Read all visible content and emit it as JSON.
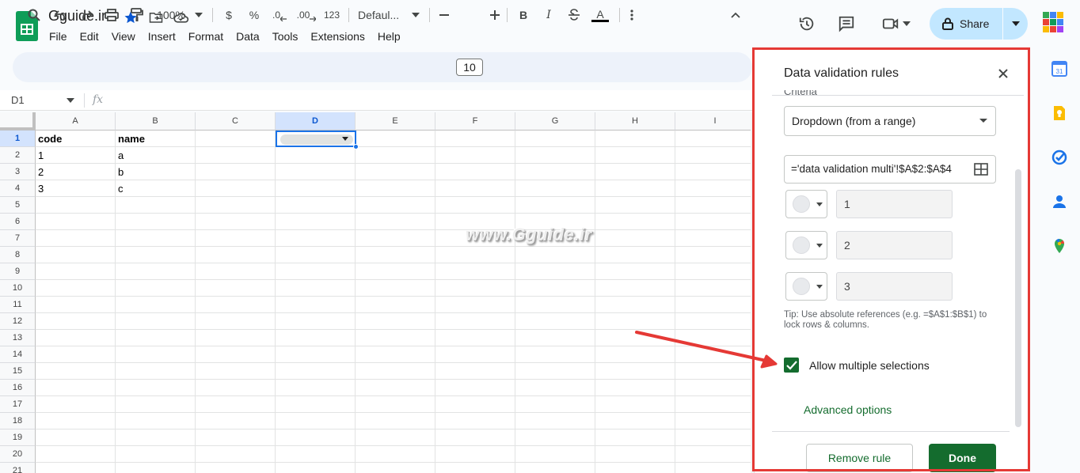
{
  "header": {
    "doc_title": "Gguide.ir",
    "menu": [
      "File",
      "Edit",
      "View",
      "Insert",
      "Format",
      "Data",
      "Tools",
      "Extensions",
      "Help"
    ],
    "share_label": "Share"
  },
  "toolbar": {
    "zoom": "100%",
    "currency": "$",
    "percent": "%",
    "dec_decrease": ".0",
    "dec_increase": ".00",
    "number_format": "123",
    "font_family": "Defaul...",
    "font_size": "10",
    "bold": "B",
    "italic": "I",
    "text_color": "A"
  },
  "formula_bar": {
    "name_box": "D1",
    "fx": "fx"
  },
  "grid": {
    "columns": [
      "A",
      "B",
      "C",
      "D",
      "E",
      "F",
      "G",
      "H",
      "I"
    ],
    "rows": [
      "1",
      "2",
      "3",
      "4",
      "5",
      "6",
      "7",
      "8",
      "9",
      "10",
      "11",
      "12",
      "13",
      "14",
      "15",
      "16",
      "17",
      "18",
      "19",
      "20",
      "21"
    ],
    "cells": {
      "A1": "code",
      "B1": "name",
      "A2": "1",
      "B2": "a",
      "A3": "2",
      "B3": "b",
      "A4": "3",
      "B4": "c"
    },
    "selected_cell": "D1"
  },
  "watermark": "www.Gguide.ir",
  "panel": {
    "title": "Data validation rules",
    "criteria_label": "Criteria",
    "criteria_value": "Dropdown (from a range)",
    "range_value": "='data validation multi'!$A$2:$A$4",
    "options": [
      "1",
      "2",
      "3"
    ],
    "tip": "Tip: Use absolute references (e.g. =$A$1:$B$1) to lock rows & columns.",
    "allow_multiple_label": "Allow multiple selections",
    "allow_multiple_checked": true,
    "advanced_options": "Advanced options",
    "remove_rule": "Remove rule",
    "done": "Done"
  },
  "colors": {
    "accent_green": "#146c2e",
    "share_bg": "#c2e7ff",
    "selection_blue": "#1a73e8",
    "annotation_red": "#e53935"
  }
}
